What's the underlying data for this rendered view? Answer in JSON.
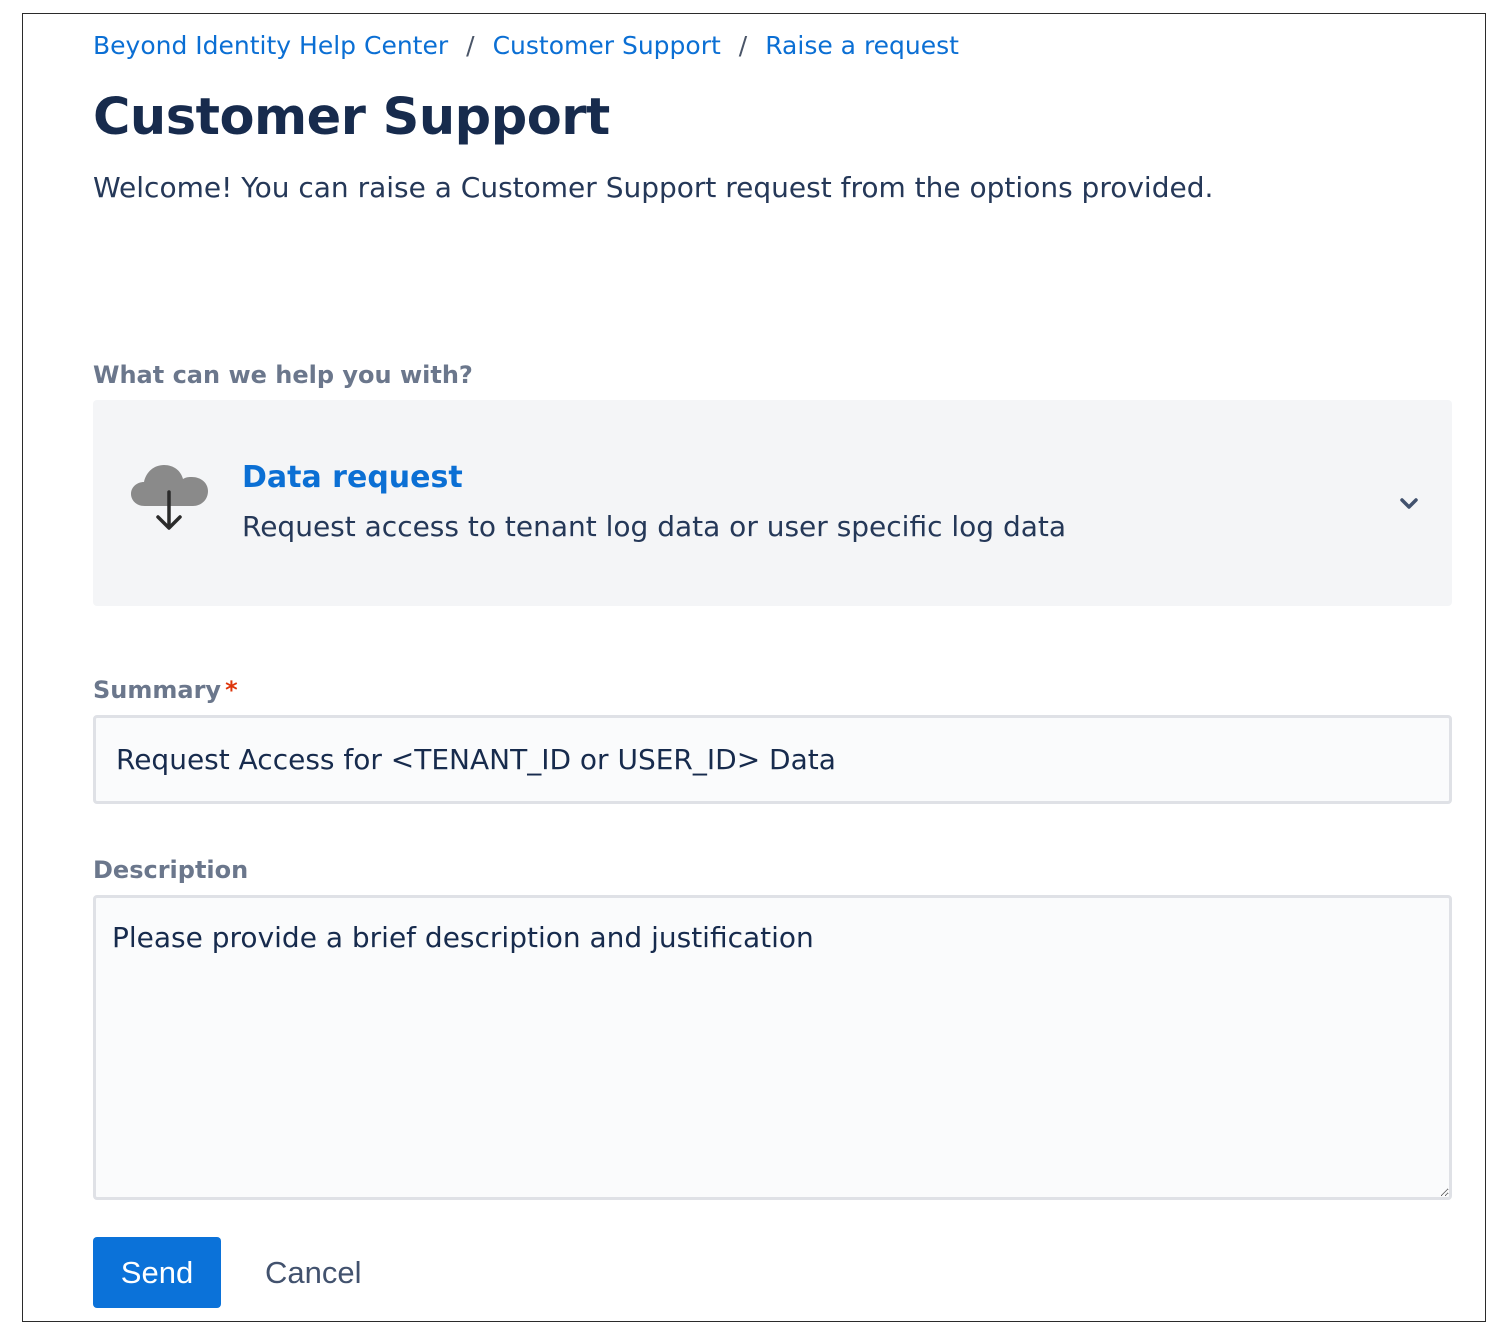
{
  "breadcrumb": {
    "items": [
      "Beyond Identity Help Center",
      "Customer Support",
      "Raise a request"
    ],
    "separator": "/"
  },
  "page": {
    "title": "Customer Support",
    "description": "Welcome! You can raise a Customer Support request from the options provided."
  },
  "request_type": {
    "label": "What can we help you with?",
    "selected_title": "Data request",
    "selected_description": "Request access to tenant log data or user specific log data",
    "icon": "cloud-download-icon"
  },
  "summary": {
    "label": "Summary",
    "required_marker": "*",
    "value": "Request Access for <TENANT_ID or USER_ID> Data"
  },
  "description": {
    "label": "Description",
    "value": "Please provide a brief description and justification"
  },
  "actions": {
    "send_label": "Send",
    "cancel_label": "Cancel"
  },
  "colors": {
    "link": "#0b6fd4",
    "primary_button": "#0b72d9",
    "heading": "#172b4d",
    "label": "#6b778c",
    "required": "#de350b",
    "picker_background": "#f4f5f7"
  }
}
